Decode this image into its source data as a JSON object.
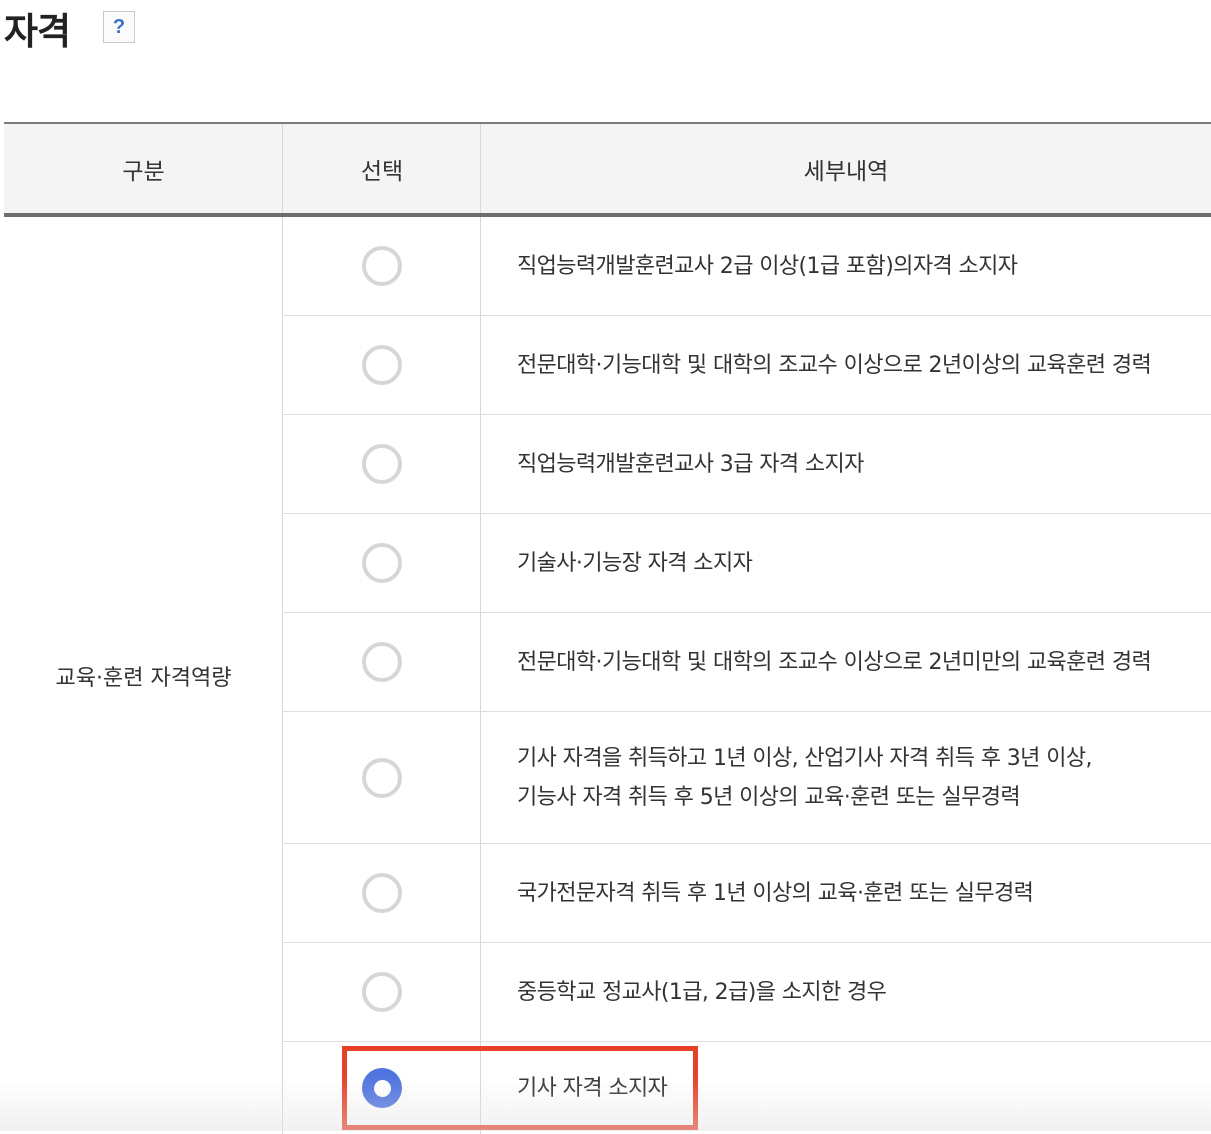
{
  "page": {
    "title": "자격",
    "help_label": "?"
  },
  "table": {
    "headers": [
      "구분",
      "선택",
      "세부내역"
    ],
    "category": "교육·훈련 자격역량",
    "rows": [
      {
        "lines": [
          "직업능력개발훈련교사 2급 이상(1급 포함)의자격 소지자"
        ],
        "selected": false
      },
      {
        "lines": [
          "전문대학·기능대학 및 대학의 조교수 이상으로 2년이상의 교육훈련 경력"
        ],
        "selected": false
      },
      {
        "lines": [
          "직업능력개발훈련교사 3급 자격 소지자"
        ],
        "selected": false
      },
      {
        "lines": [
          "기술사·기능장 자격 소지자"
        ],
        "selected": false
      },
      {
        "lines": [
          "전문대학·기능대학 및 대학의 조교수 이상으로 2년미만의 교육훈련 경력"
        ],
        "selected": false
      },
      {
        "lines": [
          "기사 자격을 취득하고 1년 이상, 산업기사 자격 취득 후 3년 이상,",
          "기능사 자격 취득 후 5년 이상의 교육·훈련 또는 실무경력"
        ],
        "selected": false
      },
      {
        "lines": [
          "국가전문자격 취득 후 1년 이상의 교육·훈련 또는 실무경력"
        ],
        "selected": false
      },
      {
        "lines": [
          "중등학교 정교사(1급, 2급)을 소지한 경우"
        ],
        "selected": false
      },
      {
        "lines": [
          "기사 자격 소지자"
        ],
        "selected": true
      }
    ]
  },
  "colors": {
    "highlight": "#e8412a",
    "radio_selected": "#4f74e0",
    "radio_unselected": "#d6d6d6",
    "header_bg": "#f4f4f4"
  }
}
